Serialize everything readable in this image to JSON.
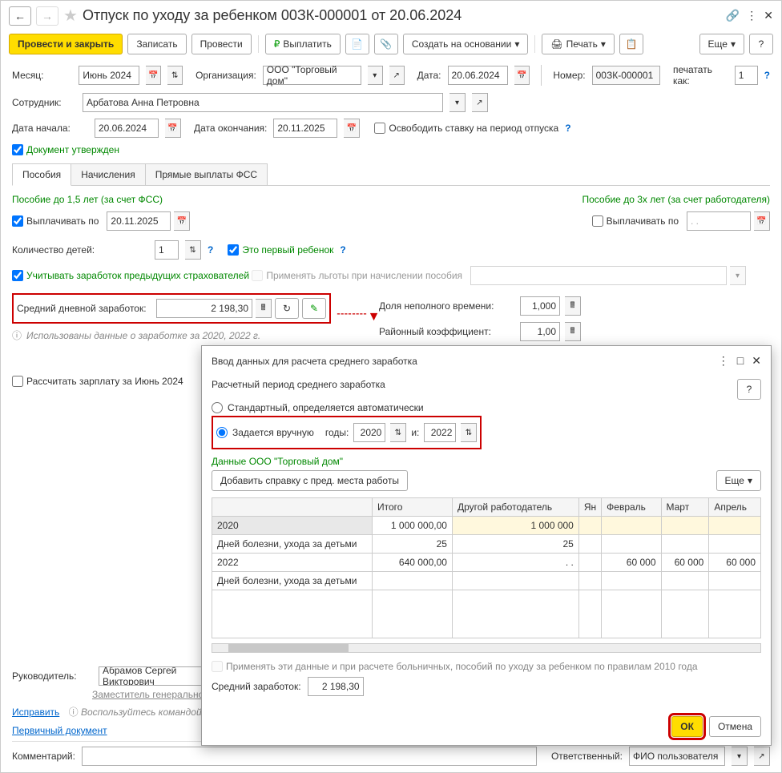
{
  "titlebar": {
    "title": "Отпуск по уходу за ребенком 00ЗК-000001 от 20.06.2024"
  },
  "toolbar": {
    "post_close": "Провести и закрыть",
    "save": "Записать",
    "post": "Провести",
    "pay": "Выплатить",
    "create_based": "Создать на основании",
    "print": "Печать",
    "more": "Еще"
  },
  "header": {
    "month_lbl": "Месяц:",
    "month": "Июнь 2024",
    "org_lbl": "Организация:",
    "org": "ООО \"Торговый дом\"",
    "date_lbl": "Дата:",
    "date": "20.06.2024",
    "num_lbl": "Номер:",
    "num": "00ЗК-000001",
    "print_as_lbl": "печатать как:",
    "print_as": "1",
    "emp_lbl": "Сотрудник:",
    "emp": "Арбатова Анна Петровна",
    "start_lbl": "Дата начала:",
    "start": "20.06.2024",
    "end_lbl": "Дата окончания:",
    "end": "20.11.2025",
    "free_rate": "Освободить ставку на период отпуска",
    "approved": "Документ утвержден"
  },
  "tabs": {
    "t1": "Пособия",
    "t2": "Начисления",
    "t3": "Прямые выплаты ФСС"
  },
  "benefits": {
    "h15": "Пособие до 1,5 лет (за счет ФСС)",
    "h3": "Пособие до 3х лет (за счет работодателя)",
    "pay_until": "Выплачивать по",
    "pay_date": "20.11.2025",
    "pay_date2": ". .",
    "children_lbl": "Количество детей:",
    "children": "1",
    "first_child": "Это первый ребенок",
    "prev_ins": "Учитывать заработок предыдущих страхователей",
    "apply_ben": "Применять льготы при начислении пособия",
    "avg_lbl": "Средний дневной заработок:",
    "avg": "2 198,30",
    "info": "Использованы данные о заработке за  2020,  2022 г.",
    "part_lbl": "Доля неполного времени:",
    "part": "1,000",
    "region_lbl": "Районный коэффициент:",
    "region": "1,00",
    "recalc": "Рассчитать зарплату за Июнь 2024"
  },
  "bottom": {
    "head_lbl": "Руководитель:",
    "head": "Абрамов Сергей Викторович",
    "head_pos": "Заместитель генерального",
    "fix": "Исправить",
    "tip": "Воспользуйтесь командой",
    "primary": "Первичный документ",
    "comment_lbl": "Комментарий:",
    "resp_lbl": "Ответственный:",
    "resp": "ФИО пользователя"
  },
  "dialog": {
    "title": "Ввод данных для расчета среднего заработка",
    "period_lbl": "Расчетный период среднего заработка",
    "std": "Стандартный, определяется автоматически",
    "manual": "Задается вручную",
    "years_lbl": "годы:",
    "y1": "2020",
    "and": "и:",
    "y2": "2022",
    "data_lbl": "Данные ООО \"Торговый дом\"",
    "add_ref": "Добавить справку с пред. места работы",
    "more": "Еще",
    "cols": {
      "c1": "",
      "c2": "Итого",
      "c3": "Другой работодатель",
      "c4": "Ян",
      "c5": "Февраль",
      "c6": "Март",
      "c7": "Апрель"
    },
    "rows": [
      {
        "c1": "2020",
        "c2": "1 000 000,00",
        "c3": "1 000 000",
        "c4": "",
        "c5": "",
        "c6": "",
        "c7": ""
      },
      {
        "c1": "Дней болезни, ухода за детьми",
        "c2": "25",
        "c3": "25",
        "c4": "",
        "c5": "",
        "c6": "",
        "c7": ""
      },
      {
        "c1": "2022",
        "c2": "640 000,00",
        "c3": ". .",
        "c4": "",
        "c5": "60 000",
        "c6": "60 000",
        "c7": "60 000"
      },
      {
        "c1": "Дней болезни, ухода за детьми",
        "c2": "",
        "c3": "",
        "c4": "",
        "c5": "",
        "c6": "",
        "c7": ""
      }
    ],
    "apply_2010": "Применять эти данные и при расчете больничных, пособий по уходу за ребенком по правилам 2010 года",
    "avg_lbl": "Средний заработок:",
    "avg": "2 198,30",
    "ok": "ОК",
    "cancel": "Отмена"
  }
}
